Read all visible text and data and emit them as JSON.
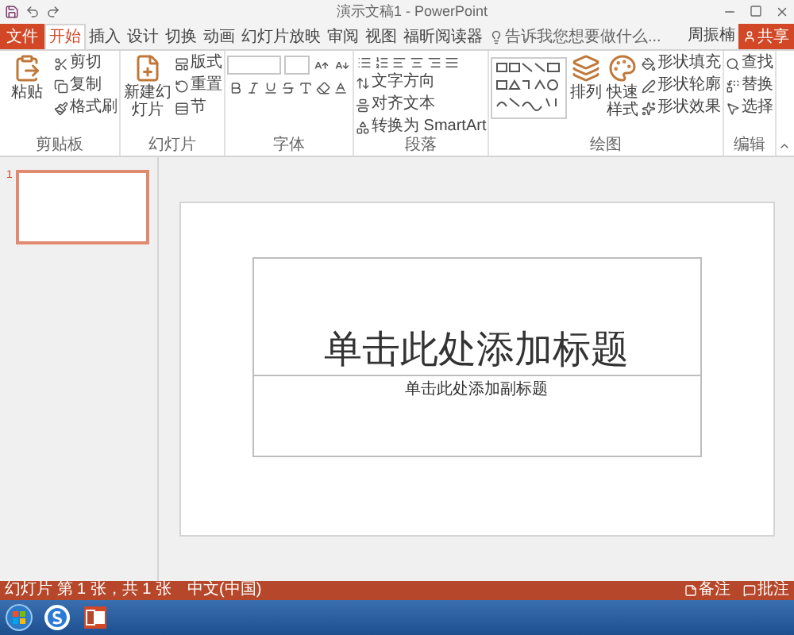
{
  "title_bar": {
    "title": "演示文稿1 - PowerPoint"
  },
  "tabs": [
    {
      "label": "文件",
      "kind": "file",
      "selected": false
    },
    {
      "label": "开始",
      "kind": "tab",
      "selected": true
    },
    {
      "label": "插入",
      "kind": "tab",
      "selected": false
    },
    {
      "label": "设计",
      "kind": "tab",
      "selected": false
    },
    {
      "label": "切换",
      "kind": "tab",
      "selected": false
    },
    {
      "label": "动画",
      "kind": "tab",
      "selected": false
    },
    {
      "label": "幻灯片放映",
      "kind": "tab",
      "selected": false
    },
    {
      "label": "审阅",
      "kind": "tab",
      "selected": false
    },
    {
      "label": "视图",
      "kind": "tab",
      "selected": false
    },
    {
      "label": "福昕阅读器",
      "kind": "tab",
      "selected": false
    }
  ],
  "tell_me": {
    "placeholder": "告诉我您想要做什么..."
  },
  "user": "周振楠",
  "share": "共享",
  "ribbon": [
    {
      "label": "剪贴板",
      "kind": "clipboard",
      "big": [
        "粘贴"
      ],
      "items": [
        "剪切",
        "复制",
        "格式刷"
      ]
    },
    {
      "label": "幻灯片",
      "kind": "slides",
      "big": [
        "新建幻灯片"
      ],
      "items": [
        "版式",
        "重置",
        "节"
      ]
    },
    {
      "label": "字体",
      "kind": "font"
    },
    {
      "label": "段落",
      "kind": "paragraph",
      "items": [
        "文字方向",
        "对齐文本",
        "转换为 SmartArt"
      ]
    },
    {
      "label": "绘图",
      "kind": "drawing",
      "big": [
        "排列",
        "快速样式"
      ],
      "items": [
        "形状填充",
        "形状轮廓",
        "形状效果"
      ]
    },
    {
      "label": "编辑",
      "kind": "editing",
      "items": [
        "查找",
        "替换",
        "选择"
      ]
    }
  ],
  "thumbnails": [
    {
      "number": "1",
      "selected": true
    }
  ],
  "slide": {
    "title_placeholder": "单击此处添加标题",
    "subtitle_placeholder": "单击此处添加副标题"
  },
  "status_bar": {
    "left": [
      "幻灯片 第 1 张，共 1 张",
      "中文(中国)"
    ],
    "right": [
      "备注",
      "批注"
    ]
  }
}
